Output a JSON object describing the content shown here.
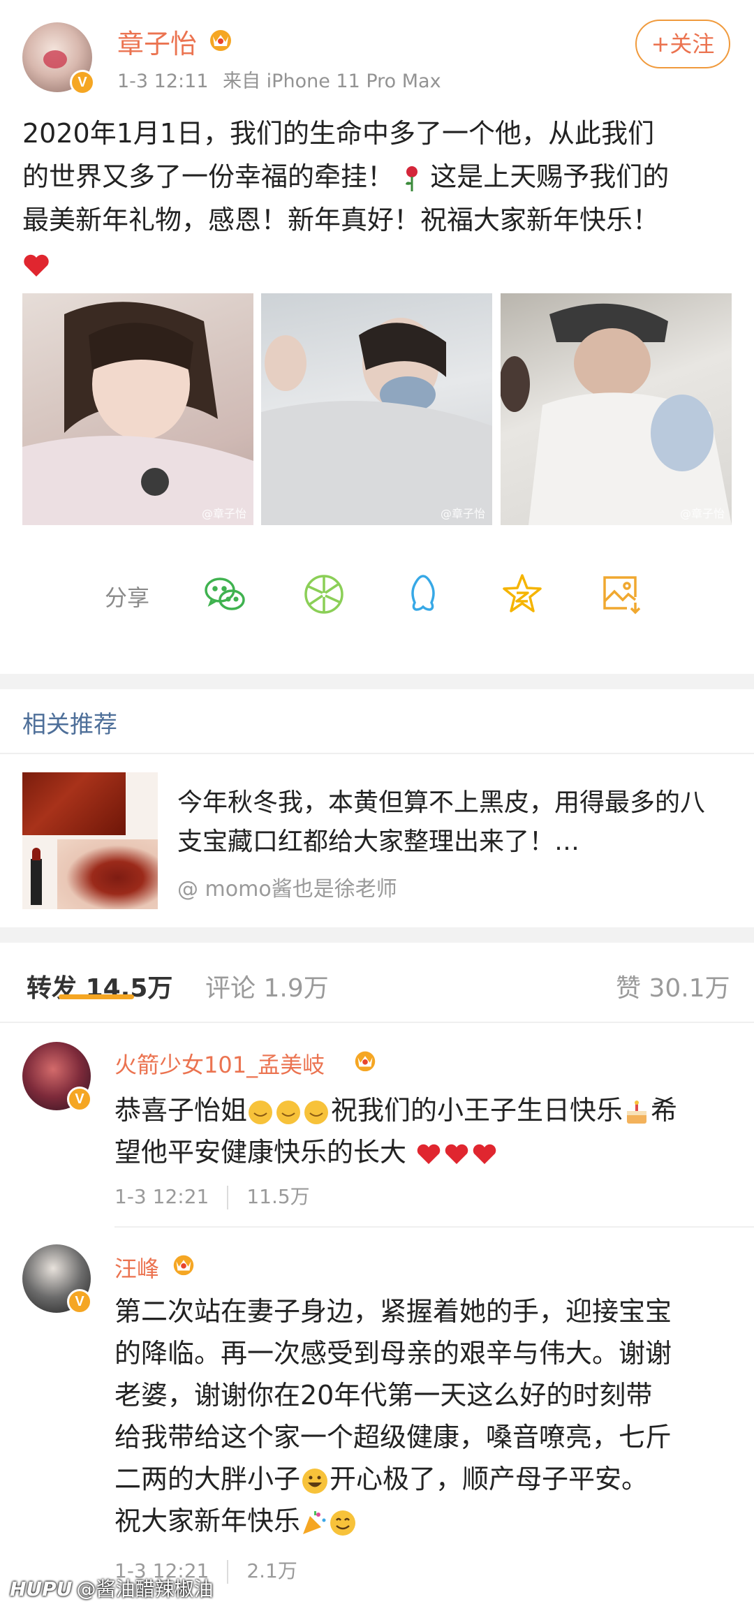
{
  "post": {
    "author": "章子怡",
    "time": "1-3 12:11",
    "source": "来自 iPhone 11 Pro Max",
    "follow_label": "+关注",
    "text_line1": "2020年1月1日，我们的生命中多了一个他，从此我们",
    "text_line2a": "的世界又多了一份幸福的牵挂！",
    "text_line2b": "这是上天赐予我们的",
    "text_line3": "最美新年礼物，感恩！新年真好！祝福大家新年快乐！",
    "photo_watermark": "@章子怡"
  },
  "share": {
    "label": "分享",
    "icons": [
      "wechat-icon",
      "moments-icon",
      "qq-icon",
      "qzone-icon",
      "save-image-icon"
    ]
  },
  "related": {
    "title": "相关推荐",
    "text": "今年秋冬我，本黄但算不上黑皮，用得最多的八支宝藏口红都给大家整理出来了！…",
    "source": "@ momo酱也是徐老师"
  },
  "tabs": {
    "reposts_label": "转发",
    "reposts_count": "14.5万",
    "comments_label": "评论",
    "comments_count": "1.9万",
    "likes_label": "赞",
    "likes_count": "30.1万"
  },
  "comments": [
    {
      "name": "火箭少女101_孟美岐",
      "text_a": "恭喜子怡姐",
      "text_b": "祝我们的小王子生日快乐",
      "text_c": "希",
      "text_d": "望他平安健康快乐的长大",
      "time": "1-3 12:21",
      "likes": "11.5万"
    },
    {
      "name": "汪峰",
      "line1": "第二次站在妻子身边，紧握着她的手，迎接宝宝",
      "line2": "的降临。再一次感受到母亲的艰辛与伟大。谢谢",
      "line3": "老婆，谢谢你在20年代第一天这么好的时刻带",
      "line4": "给我带给这个家一个超级健康，嗓音嘹亮，七斤",
      "line5a": "二两的大胖小子",
      "line5b": "开心极了，顺产母子平安。",
      "line6": "祝大家新年快乐",
      "time": "1-3 12:21",
      "likes": "2.1万"
    }
  ],
  "footer": {
    "brand": "HUPU",
    "handle": "@酱油醋辣椒油"
  },
  "colors": {
    "accent_orange": "#eb7350",
    "gold": "#f5a623",
    "link_blue": "#4e6f99"
  }
}
